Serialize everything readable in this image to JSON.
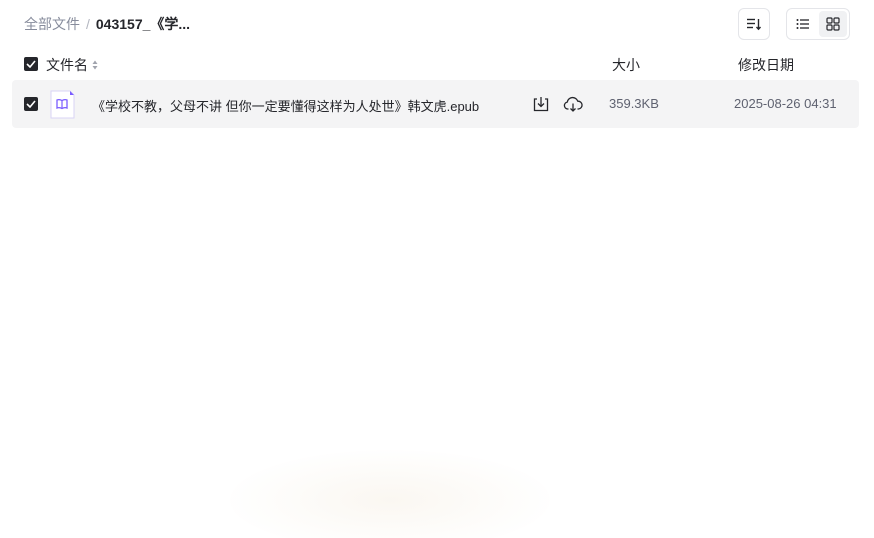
{
  "breadcrumb": {
    "root": "全部文件",
    "separator": "/",
    "current": "043157_《学..."
  },
  "toolbar": {
    "sort_icon": "sort-icon",
    "list_view_icon": "list-view-icon",
    "grid_view_icon": "grid-view-icon",
    "active_view": "list"
  },
  "table": {
    "headers": {
      "name": "文件名",
      "size": "大小",
      "date": "修改日期"
    },
    "all_selected": true,
    "rows": [
      {
        "name": "《学校不教，父母不讲 但你一定要懂得这样为人处世》韩文虎.epub",
        "size": "359.3KB",
        "date": "2025-08-26 04:31",
        "selected": true,
        "icon": "book-file-icon"
      }
    ]
  },
  "colors": {
    "text_primary": "#25262b",
    "text_secondary": "#878c9c",
    "row_background": "#f4f4f5",
    "file_icon_accent": "#7a5cff"
  }
}
